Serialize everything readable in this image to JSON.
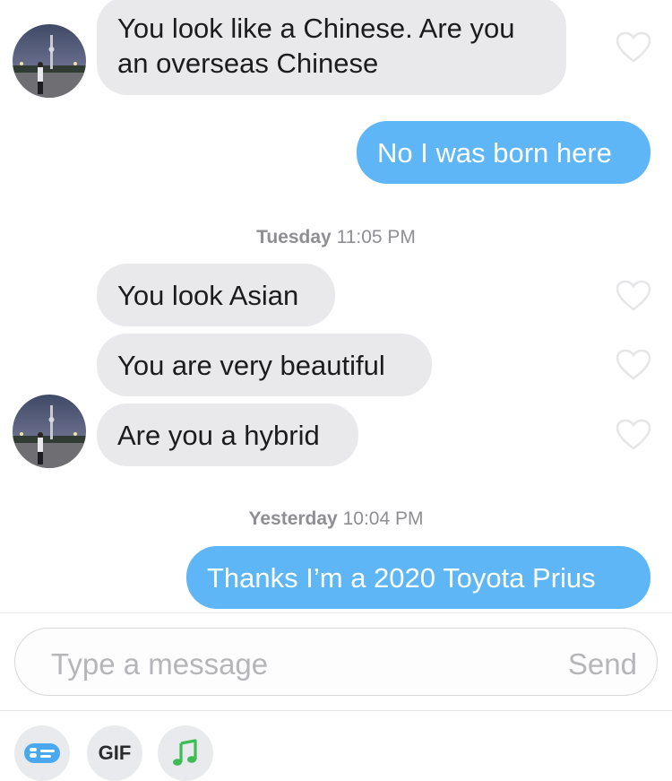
{
  "messages": {
    "m1": "You look like a Chinese. Are you",
    "m1b": "an overseas Chinese",
    "m2": "No I was born here",
    "m3": "You look Asian",
    "m4": "You are very beautiful",
    "m5": "Are you a hybrid",
    "m6": "Thanks I’m a 2020 Toyota Prius"
  },
  "timestamps": {
    "t1_day": "Tuesday",
    "t1_time": "11:05 PM",
    "t2_day": "Yesterday",
    "t2_time": "10:04 PM"
  },
  "composer": {
    "placeholder": "Type a message",
    "send_label": "Send"
  },
  "toolbar": {
    "gif_label": "GIF"
  },
  "colors": {
    "incoming_bubble": "#e9e9eb",
    "outgoing_bubble": "#5fb6f6",
    "music_icon": "#3dbb55"
  }
}
